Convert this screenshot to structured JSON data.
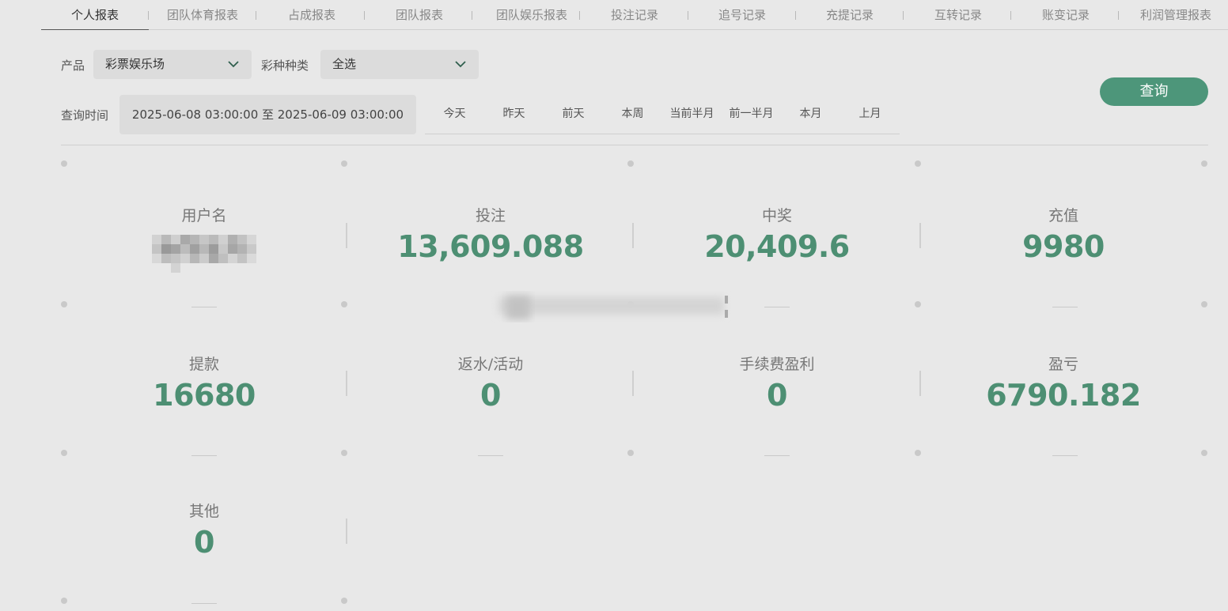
{
  "tabs": [
    {
      "label": "个人报表",
      "active": true
    },
    {
      "label": "团队体育报表"
    },
    {
      "label": "占成报表"
    },
    {
      "label": "团队报表"
    },
    {
      "label": "团队娱乐报表"
    },
    {
      "label": "投注记录"
    },
    {
      "label": "追号记录"
    },
    {
      "label": "充提记录"
    },
    {
      "label": "互转记录"
    },
    {
      "label": "账变记录"
    },
    {
      "label": "利润管理报表"
    }
  ],
  "filters": {
    "product_label": "产品",
    "product_value": "彩票娱乐场",
    "lottery_type_label": "彩种种类",
    "lottery_type_value": "全选",
    "time_label": "查询时间",
    "date_range": "2025-06-08 03:00:00 至 2025-06-09 03:00:00",
    "quick_ranges": [
      "今天",
      "昨天",
      "前天",
      "本周",
      "当前半月",
      "前一半月",
      "本月",
      "上月"
    ],
    "query_button": "查询"
  },
  "stats": {
    "username_label": "用户名",
    "bet_label": "投注",
    "bet_value": "13,609.088",
    "win_label": "中奖",
    "win_value": "20,409.6",
    "deposit_label": "充值",
    "deposit_value": "9980",
    "withdraw_label": "提款",
    "withdraw_value": "16680",
    "rebate_label": "返水/活动",
    "rebate_value": "0",
    "fee_profit_label": "手续费盈利",
    "fee_profit_value": "0",
    "pnl_label": "盈亏",
    "pnl_value": "6790.182",
    "other_label": "其他",
    "other_value": "0"
  },
  "icons": {
    "dropdown": "chevron-down-icon"
  },
  "colors": {
    "accent": "#4d967a",
    "value_text": "#4d8f73",
    "background": "#e8e8e8",
    "select_bg": "#dcdcdc"
  }
}
